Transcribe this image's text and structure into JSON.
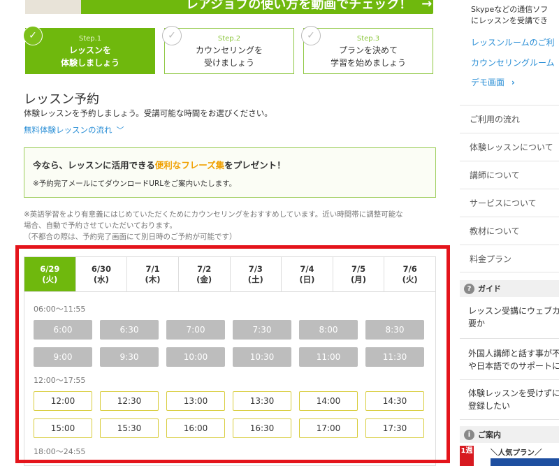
{
  "banner": {
    "text": "レアジョブの使い方を動画でチェック！",
    "arrow": "→"
  },
  "steps": [
    {
      "num": "Step.1",
      "line1": "レッスンを",
      "line2": "体験しましょう",
      "active": true
    },
    {
      "num": "Step.2",
      "line1": "カウンセリングを",
      "line2": "受けましょう",
      "active": false
    },
    {
      "num": "Step.3",
      "line1": "プランを決めて",
      "line2": "学習を始めましょう",
      "active": false
    }
  ],
  "reservation": {
    "title": "レッスン予約",
    "subtitle": "体験レッスンを予約しましょう。受講可能な時間をお選びください。",
    "flow_link": "無料体験レッスンの流れ",
    "present_pre": "今なら、レッスンに活用できる",
    "present_highlight": "便利なフレーズ集",
    "present_post": "をプレゼント！",
    "present_note": "※予約完了メールにてダウンロードURLをご案内いたします。",
    "note_line1": "※英語学習をより有意義にはじめていただくためにカウンセリングをおすすめしています。近い時間帯に調整可能な",
    "note_line2": "場合、自動で予約させていただいております。",
    "note_line3": "（不都合の際は、予約完了画面にて別日時のご予約が可能です）"
  },
  "calendar": {
    "dates": [
      {
        "date": "6/29",
        "day": "(火)",
        "active": true
      },
      {
        "date": "6/30",
        "day": "(水)",
        "active": false
      },
      {
        "date": "7/1",
        "day": "(木)",
        "active": false
      },
      {
        "date": "7/2",
        "day": "(金)",
        "active": false
      },
      {
        "date": "7/3",
        "day": "(土)",
        "active": false
      },
      {
        "date": "7/4",
        "day": "(日)",
        "active": false
      },
      {
        "date": "7/5",
        "day": "(月)",
        "active": false
      },
      {
        "date": "7/6",
        "day": "(火)",
        "active": false
      }
    ],
    "periods": [
      {
        "label": "06:00〜11:55",
        "available": false,
        "rows": [
          [
            "6:00",
            "6:30",
            "7:00",
            "7:30",
            "8:00",
            "8:30"
          ],
          [
            "9:00",
            "9:30",
            "10:00",
            "10:30",
            "11:00",
            "11:30"
          ]
        ]
      },
      {
        "label": "12:00〜17:55",
        "available": true,
        "rows": [
          [
            "12:00",
            "12:30",
            "13:00",
            "13:30",
            "14:00",
            "14:30"
          ],
          [
            "15:00",
            "15:30",
            "16:00",
            "16:30",
            "17:00",
            "17:30"
          ]
        ]
      },
      {
        "label": "18:00〜24:55",
        "available": true,
        "rows": []
      }
    ]
  },
  "sidebar": {
    "text_line1": "Skypeなどの通信ソフ",
    "text_line2": "にレッスンを受講でき",
    "link1": "レッスンルームのご利",
    "link2": "カウンセリングルーム",
    "link3": "デモ画面",
    "link3_chevron": "›",
    "menu": [
      "ご利用の流れ",
      "体験レッスンについて",
      "講師について",
      "サービスについて",
      "教材について",
      "料金プラン"
    ],
    "guide_title": "ガイド",
    "guide_icon": "?",
    "guide_items": [
      {
        "line1": "レッスン受講にウェブカ",
        "line2": "要か"
      },
      {
        "line1": "外国人講師と話す事が不",
        "line2": "や日本語でのサポートに"
      },
      {
        "line1": "体験レッスンを受けずに",
        "line2": "登録したい"
      }
    ],
    "info_title": "ご案内",
    "info_icon": "i",
    "badge_red": "1週",
    "badge_text": "＼人気プラン／"
  },
  "colors": {
    "green": "#6fb80d",
    "red_frame": "#e4141b",
    "link": "#2b8fd6",
    "slot_off": "#bdbdbd",
    "slot_on_border": "#d8cc3a"
  }
}
